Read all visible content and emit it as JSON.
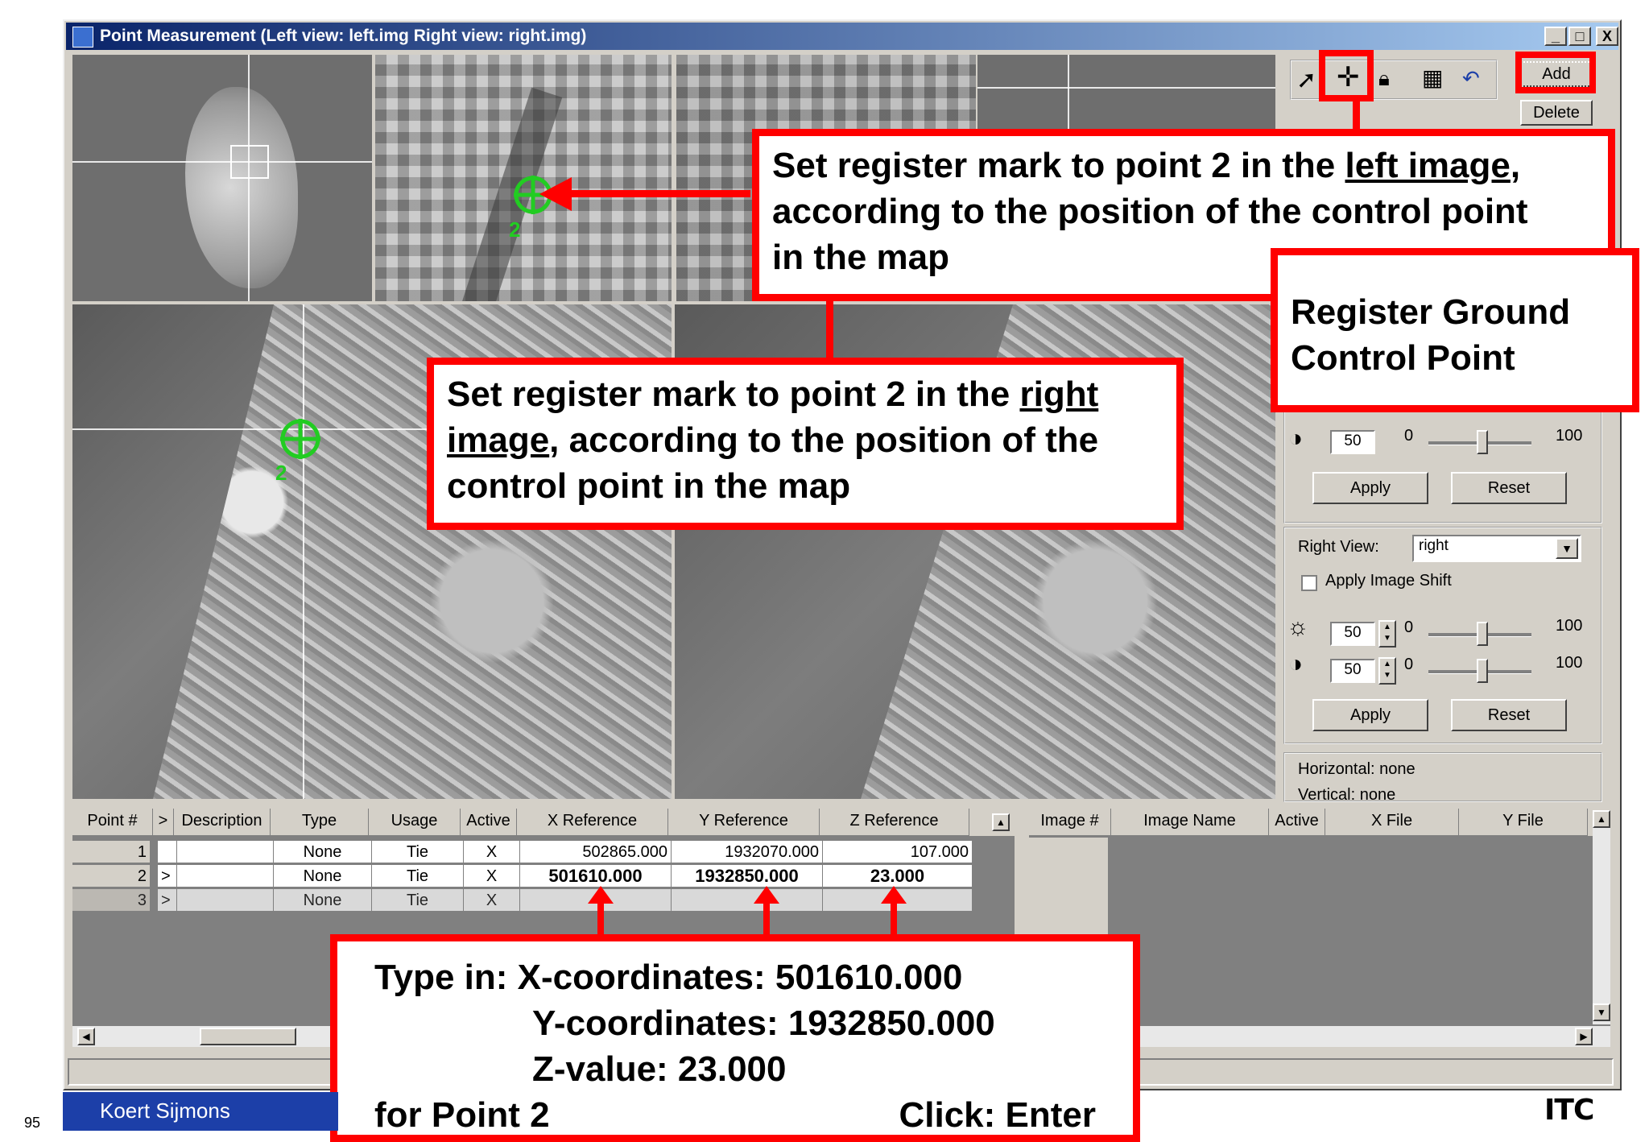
{
  "window": {
    "title": "Point Measurement (Left view: left.img  Right view: right.img)",
    "buttons": {
      "minimize": "_",
      "maximize": "□",
      "close": "X"
    }
  },
  "views": {
    "mark_label": "2"
  },
  "toolbar": {
    "add_label": "Add",
    "delete_label": "Delete"
  },
  "panel": {
    "left_brightness_value": "50",
    "left_contrast_value": "50",
    "slider_min": "0",
    "slider_max": "100",
    "apply_label": "Apply",
    "reset_label": "Reset",
    "right_view_label": "Right View:",
    "right_view_value": "right",
    "apply_image_shift_label": "Apply Image Shift",
    "right_brightness_value": "50",
    "right_contrast_value": "50",
    "horizontal_label": "Horizontal: none",
    "vertical_label": "Vertical: none"
  },
  "point_table": {
    "headers": [
      "Point #",
      ">",
      "Description",
      "Type",
      "Usage",
      "Active",
      "X Reference",
      "Y Reference",
      "Z Reference"
    ],
    "rows": [
      {
        "num": "1",
        "sel": "",
        "desc": "",
        "type": "None",
        "usage": "Tie",
        "active": "X",
        "x": "502865.000",
        "y": "1932070.000",
        "z": "107.000"
      },
      {
        "num": "2",
        "sel": ">",
        "desc": "",
        "type": "None",
        "usage": "Tie",
        "active": "X",
        "x": "501610.000",
        "y": "1932850.000",
        "z": "23.000"
      },
      {
        "num": "3",
        "sel": ">",
        "desc": "",
        "type": "None",
        "usage": "Tie",
        "active": "X",
        "x": "",
        "y": "",
        "z": ""
      }
    ]
  },
  "image_table": {
    "headers": [
      "Image #",
      "Image Name",
      "Active",
      "X File",
      "Y File"
    ]
  },
  "callouts": {
    "left_image": {
      "line1_a": "Set register mark to point 2 in the ",
      "line1_u": "left image",
      "line1_b": ",",
      "line2": "according to the position of the control point",
      "line3": "in the map"
    },
    "register": {
      "line1": "Register Ground",
      "line2": "Control Point"
    },
    "right_image": {
      "line1_a": "Set register mark to point 2 in the ",
      "line1_u": "right",
      "line2_u": "image",
      "line2_b": ", according to the position of the",
      "line3": "control point in the map"
    },
    "type_in": {
      "line1": "Type in: X-coordinates: 501610.000",
      "line2": "Y-coordinates: 1932850.000",
      "line3": "Z-value: 23.000",
      "line4_a": "for Point 2",
      "line4_b": "Click: Enter"
    }
  },
  "footer": {
    "author": "Koert Sijmons",
    "slide_number": "95",
    "logo": "ITC"
  }
}
